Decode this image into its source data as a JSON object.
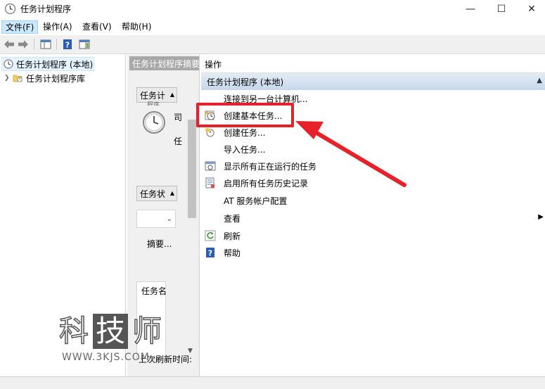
{
  "window": {
    "title": "任务计划程序",
    "min_glyph": "—",
    "max_glyph": "☐",
    "close_glyph": "✕"
  },
  "menu": {
    "items": [
      "文件(F)",
      "操作(A)",
      "查看(V)",
      "帮助(H)"
    ]
  },
  "tree": {
    "root_label": "任务计划程序 (本地)",
    "child_label": "任务计划程序库"
  },
  "middle": {
    "header": "任务计划程序摘要",
    "btn1": "任务计",
    "btn1_sub": "…程序",
    "btn2": "任务状",
    "text_a": "司",
    "text_b": "任",
    "summary": "摘要...",
    "task_name": "任务名",
    "last_refresh": "上次刷新时间:"
  },
  "actions": {
    "header": "操作",
    "section": "任务计划程序 (本地)",
    "items": [
      {
        "label": "连接到另一台计算机...",
        "icon": "none"
      },
      {
        "label": "创建基本任务...",
        "icon": "clock-task-icon"
      },
      {
        "label": "创建任务...",
        "icon": "new-task-icon"
      },
      {
        "label": "导入任务...",
        "icon": "none"
      },
      {
        "label": "显示所有正在运行的任务",
        "icon": "running-tasks-icon"
      },
      {
        "label": "启用所有任务历史记录",
        "icon": "history-icon"
      },
      {
        "label": "AT 服务帐户配置",
        "icon": "none"
      },
      {
        "label": "查看",
        "icon": "none"
      },
      {
        "label": "刷新",
        "icon": "refresh-icon"
      },
      {
        "label": "帮助",
        "icon": "help-icon"
      }
    ]
  },
  "watermark": {
    "c1": "科",
    "c2": "技",
    "c3": "师",
    "url": "WWW.3KJS.COM"
  },
  "colors": {
    "highlight": "#e8202a",
    "selection": "#cce8ff",
    "section_gradient": "#c8d8ea"
  }
}
